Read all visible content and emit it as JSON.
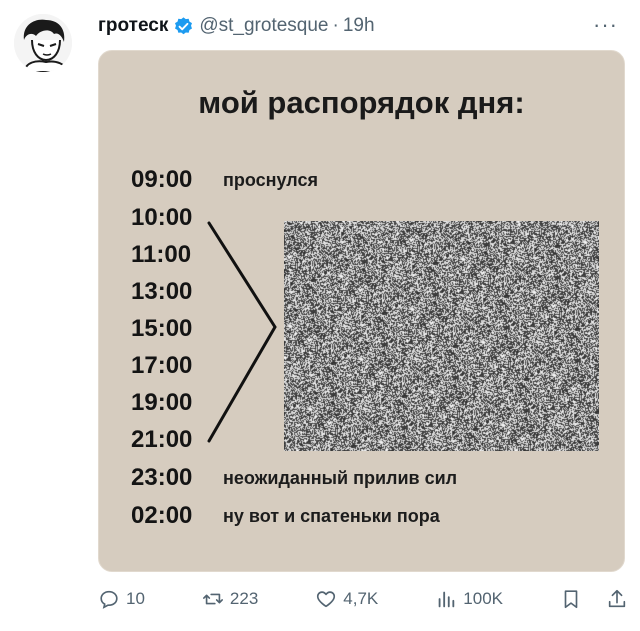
{
  "tweet": {
    "author_name": "гротеск",
    "handle": "@st_grotesque",
    "separator": "·",
    "time": "19h",
    "more_label": "···"
  },
  "image": {
    "title": "мой распорядок дня:",
    "schedule": [
      {
        "time": "09:00",
        "label": "проснулся"
      },
      {
        "time": "10:00",
        "label": ""
      },
      {
        "time": "11:00",
        "label": ""
      },
      {
        "time": "13:00",
        "label": ""
      },
      {
        "time": "15:00",
        "label": ""
      },
      {
        "time": "17:00",
        "label": ""
      },
      {
        "time": "19:00",
        "label": ""
      },
      {
        "time": "21:00",
        "label": ""
      },
      {
        "time": "23:00",
        "label": "неожиданный прилив сил"
      },
      {
        "time": "02:00",
        "label": "ну вот и спатеньки пора"
      }
    ]
  },
  "actions": {
    "replies": "10",
    "retweets": "223",
    "likes": "4,7K",
    "views": "100K"
  },
  "colors": {
    "card_bg": "#d6ccbf",
    "verified": "#1d9bf0",
    "muted": "#536471"
  }
}
